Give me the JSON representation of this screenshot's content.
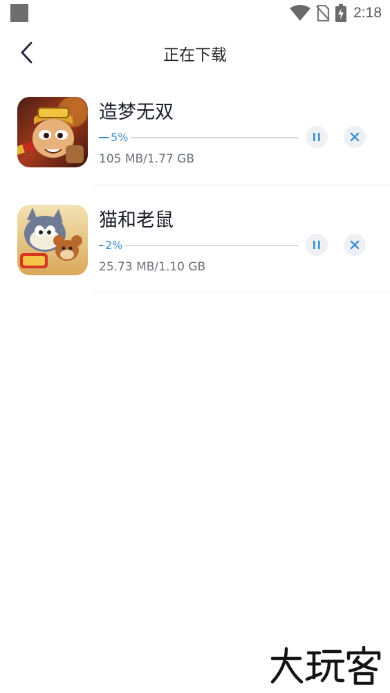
{
  "status_bar": {
    "time": "2:18"
  },
  "header": {
    "title": "正在下载"
  },
  "downloads": [
    {
      "name": "造梦无双",
      "percent_label": "5%",
      "progress": 0.05,
      "size": "105 MB/1.77 GB"
    },
    {
      "name": "猫和老鼠",
      "percent_label": "2%",
      "progress": 0.02,
      "size": "25.73 MB/1.10 GB"
    }
  ],
  "watermark": "大玩客",
  "colors": {
    "accent": "#3a8fd0",
    "icon_button_bg": "#eef0f3",
    "divider": "#eceef1"
  },
  "icons": [
    "back-arrow-icon",
    "wifi-icon",
    "no-sim-icon",
    "battery-charging-icon",
    "pause-icon",
    "close-icon"
  ]
}
